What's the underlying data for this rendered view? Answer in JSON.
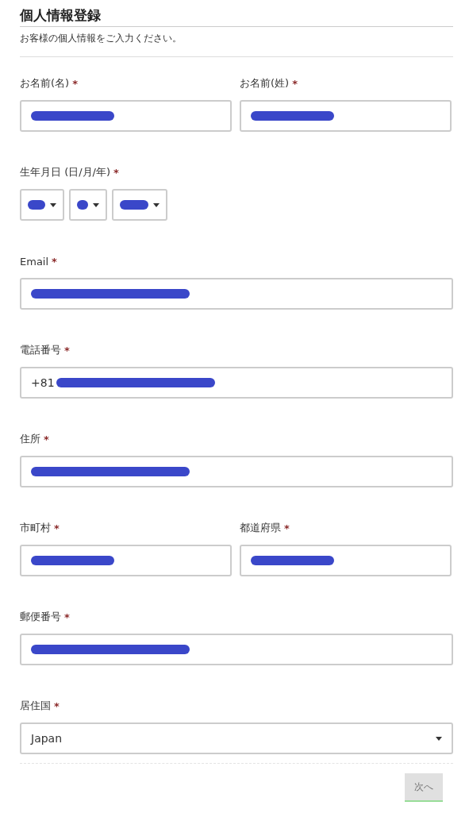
{
  "title": "個人情報登録",
  "subtitle": "お客様の個人情報をご入力ください。",
  "rows": [
    {
      "fields": [
        {
          "kind": "text",
          "label": "お名前(名)",
          "required_mark": "*",
          "redacted": true
        },
        {
          "kind": "text",
          "label": "お名前(姓)",
          "required_mark": "*",
          "redacted": true
        }
      ]
    },
    {
      "fields": [
        {
          "kind": "select-group",
          "label": "生年月日 (日/月/年)",
          "required_mark": "*",
          "redacted": true
        }
      ]
    },
    {
      "fields": [
        {
          "kind": "text",
          "label": "Email",
          "required_mark": "*",
          "redacted": true
        }
      ]
    },
    {
      "fields": [
        {
          "kind": "text",
          "label": "電話番号",
          "required_mark": "*",
          "value": "+81",
          "redacted": true
        }
      ]
    },
    {
      "fields": [
        {
          "kind": "text",
          "label": "住所",
          "required_mark": "*",
          "redacted": true
        }
      ]
    },
    {
      "fields": [
        {
          "kind": "text",
          "label": "市町村",
          "required_mark": "*",
          "redacted": true
        },
        {
          "kind": "text",
          "label": "都道府県",
          "required_mark": "*",
          "redacted": true
        }
      ]
    },
    {
      "fields": [
        {
          "kind": "text",
          "label": "郵便番号",
          "required_mark": "*",
          "redacted": true
        }
      ]
    },
    {
      "fields": [
        {
          "kind": "select",
          "label": "居住国",
          "required_mark": "*",
          "value": "Japan"
        }
      ]
    }
  ],
  "next_button": {
    "label": "次へ",
    "disabled": true
  }
}
